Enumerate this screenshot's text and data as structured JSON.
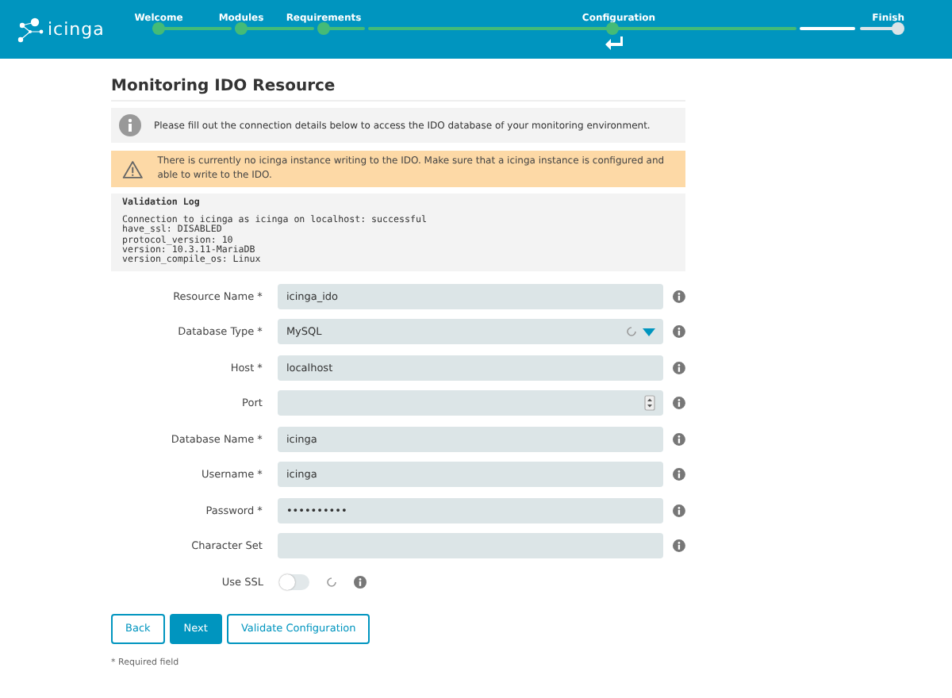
{
  "header": {
    "logo": "icinga",
    "steps": [
      {
        "label": "Welcome",
        "done": true,
        "current": false
      },
      {
        "label": "Modules",
        "done": true,
        "current": false
      },
      {
        "label": "Requirements",
        "done": true,
        "current": false
      },
      {
        "label": "Configuration",
        "done": true,
        "current": true
      },
      {
        "label": "Finish",
        "done": false,
        "current": false
      }
    ]
  },
  "title": "Monitoring IDO Resource",
  "info": "Please fill out the connection details below to access the IDO database of your monitoring environment.",
  "warning": "There is currently no icinga instance writing to the IDO. Make sure that a icinga instance is configured and able to write to the IDO.",
  "log": {
    "title": "Validation Log",
    "lines": [
      "Connection to icinga as icinga on localhost: successful",
      "have_ssl: DISABLED",
      "protocol_version: 10",
      "version: 10.3.11-MariaDB",
      "version_compile_os: Linux"
    ]
  },
  "fields": [
    {
      "label": "Resource Name *",
      "kind": "text",
      "value": "icinga_ido"
    },
    {
      "label": "Database Type *",
      "kind": "select",
      "value": "MySQL"
    },
    {
      "label": "Host *",
      "kind": "text",
      "value": "localhost"
    },
    {
      "label": "Port",
      "kind": "number"
    },
    {
      "label": "Database Name *",
      "kind": "text",
      "value": "icinga"
    },
    {
      "label": "Username *",
      "kind": "text",
      "value": "icinga"
    },
    {
      "label": "Password *",
      "kind": "password",
      "value": "••••••••••"
    },
    {
      "label": "Character Set",
      "kind": "text"
    },
    {
      "label": "Use SSL",
      "kind": "toggle",
      "on": false
    }
  ],
  "buttons": [
    {
      "label": "Back",
      "kind": "secondary"
    },
    {
      "label": "Next",
      "kind": "primary"
    },
    {
      "label": "Validate Configuration",
      "kind": "secondary"
    }
  ],
  "footnote": "* Required field"
}
